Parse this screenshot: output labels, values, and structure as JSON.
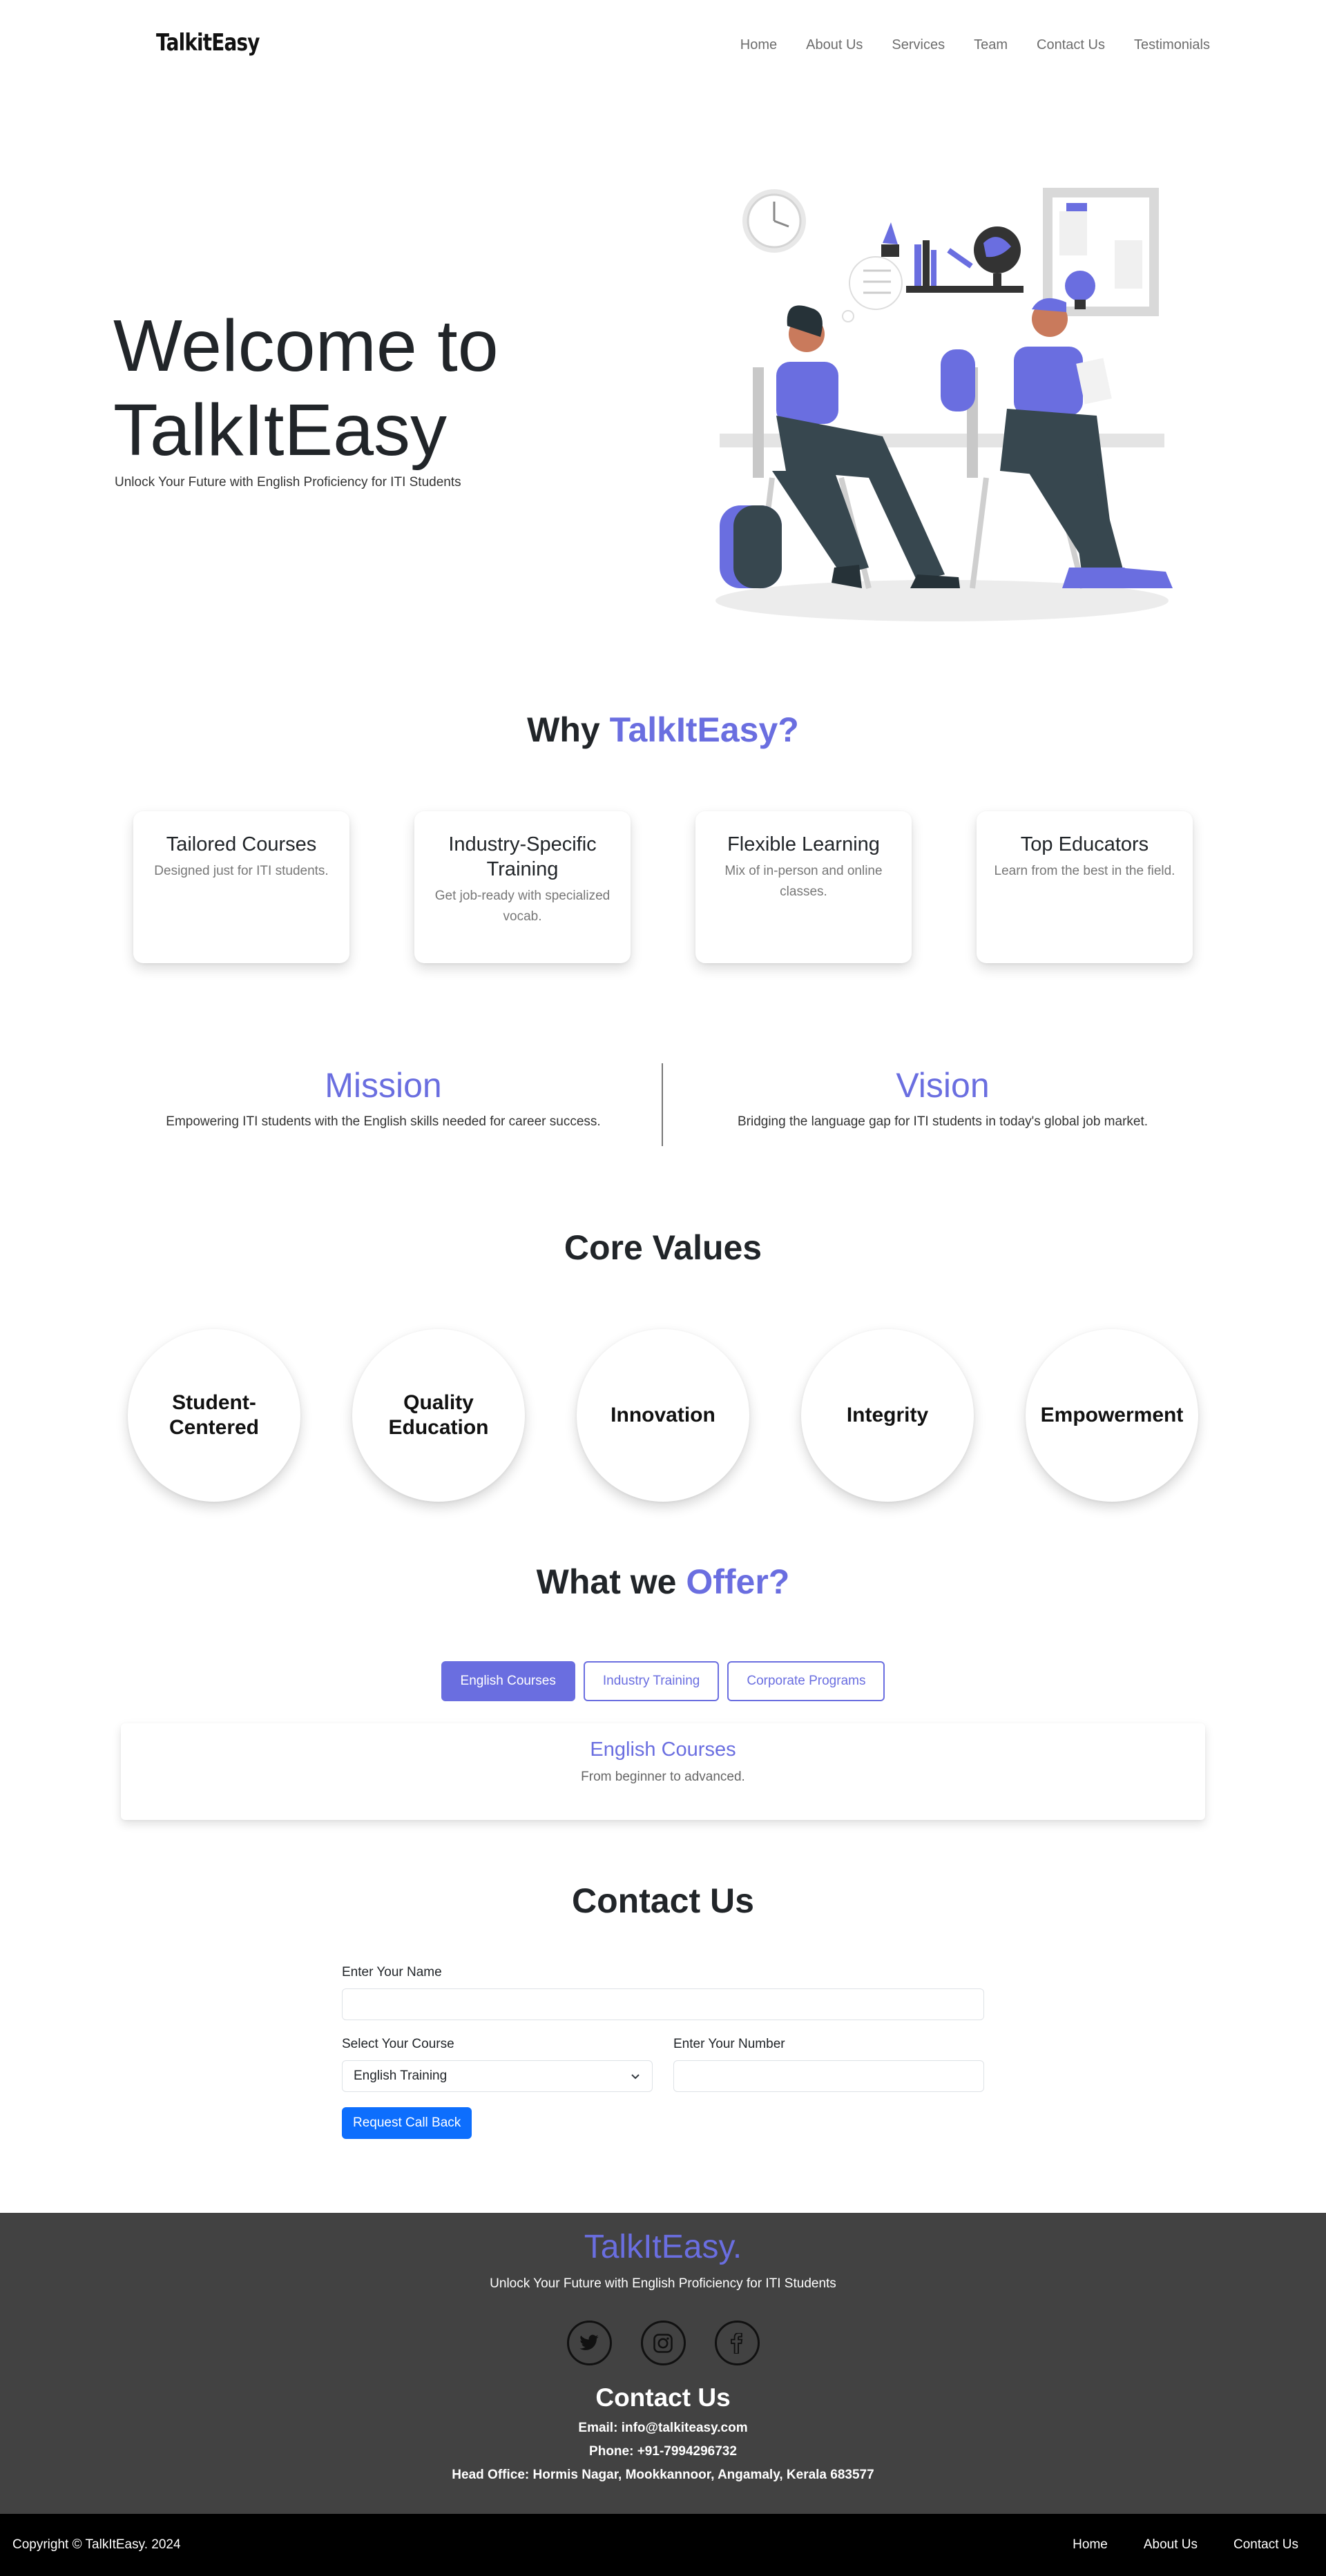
{
  "nav": {
    "brand": "TalkitEasy",
    "links": [
      "Home",
      "About Us",
      "Services",
      "Team",
      "Contact Us",
      "Testimonials"
    ]
  },
  "hero": {
    "title_line1": "Welcome to",
    "title_line2": "TalkItEasy",
    "subtitle": "Unlock Your Future with English Proficiency for ITI Students"
  },
  "why": {
    "title_plain": "Why ",
    "title_accent": "TalkItEasy?",
    "cards": [
      {
        "title": "Tailored Courses",
        "text": "Designed just for ITI students."
      },
      {
        "title": "Industry-Specific Training",
        "text": "Get job-ready with specialized vocab."
      },
      {
        "title": "Flexible Learning",
        "text": "Mix of in-person and online classes."
      },
      {
        "title": "Top Educators",
        "text": "Learn from the best in the field."
      }
    ]
  },
  "mission": {
    "title": "Mission",
    "text": "Empowering ITI students with the English skills needed for career success."
  },
  "vision": {
    "title": "Vision",
    "text": "Bridging the language gap for ITI students in today's global job market."
  },
  "core_values": {
    "title": "Core Values",
    "items": [
      "Student-Centered",
      "Quality Education",
      "Innovation",
      "Integrity",
      "Empowerment"
    ]
  },
  "offer": {
    "title_plain": "What we ",
    "title_accent": "Offer?",
    "tabs": [
      "English Courses",
      "Industry Training",
      "Corporate Programs"
    ],
    "active_tab": 0,
    "panel_title": "English Courses",
    "panel_text": "From beginner to advanced."
  },
  "contact": {
    "title": "Contact Us",
    "name_label": "Enter Your Name",
    "name_value": "",
    "course_label": "Select Your Course",
    "course_value": "English Training",
    "number_label": "Enter Your Number",
    "number_value": "",
    "submit_label": "Request Call Back"
  },
  "footer": {
    "brand": "TalkItEasy.",
    "tagline": "Unlock Your Future with English Proficiency for ITI Students",
    "socials": [
      "twitter-icon",
      "instagram-icon",
      "facebook-icon"
    ],
    "contact_title": "Contact Us",
    "email": "Email: info@talkiteasy.com",
    "phone": "Phone: +91-7994296732",
    "office": "Head Office: Hormis Nagar, Mookkannoor, Angamaly, Kerala 683577"
  },
  "bottom": {
    "copyright": "Copyright © TalkItEasy. 2024",
    "links": [
      "Home",
      "About Us",
      "Contact Us"
    ]
  },
  "colors": {
    "accent": "#6a6ee0",
    "primary_button": "#0d6efd",
    "footer_bg": "#424242",
    "bottom_bar_bg": "#000000"
  }
}
